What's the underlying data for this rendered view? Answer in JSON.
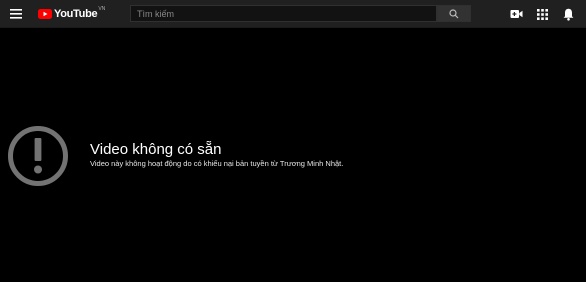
{
  "header": {
    "logo_text": "YouTube",
    "logo_country": "VN",
    "search_placeholder": "Tìm kiếm",
    "icons": [
      "menu-icon",
      "create-video-icon",
      "apps-grid-icon",
      "notifications-bell-icon"
    ]
  },
  "error": {
    "title": "Video không có sẵn",
    "description": "Video này không hoạt động do có khiếu nại bản tuyền từ Trương Minh Nhật.",
    "icon": "alert-circle-icon"
  },
  "colors": {
    "background": "#000000",
    "topbar": "#202020",
    "youtube_red": "#ff0000",
    "icon_gray": "#737373"
  }
}
